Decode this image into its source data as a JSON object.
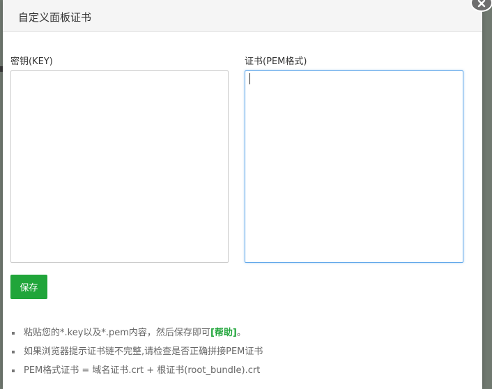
{
  "dialog": {
    "title": "自定义面板证书",
    "close_icon": "close-icon"
  },
  "form": {
    "key_label": "密钥(KEY)",
    "key_value": "",
    "cert_label": "证书(PEM格式)",
    "cert_value": "",
    "save_label": "保存"
  },
  "help": {
    "item1_prefix": "粘贴您的*.key以及*.pem内容，然后保存即可",
    "item1_link": "[帮助]",
    "item1_suffix": "。",
    "item2": "如果浏览器提示证书链不完整,请检查是否正确拼接PEM证书",
    "item3": "PEM格式证书 = 域名证书.crt + 根证书(root_bundle).crt"
  },
  "colors": {
    "accent": "#20a53a",
    "focus_border": "#62a8ea",
    "header_bg": "#f5f5f5"
  }
}
